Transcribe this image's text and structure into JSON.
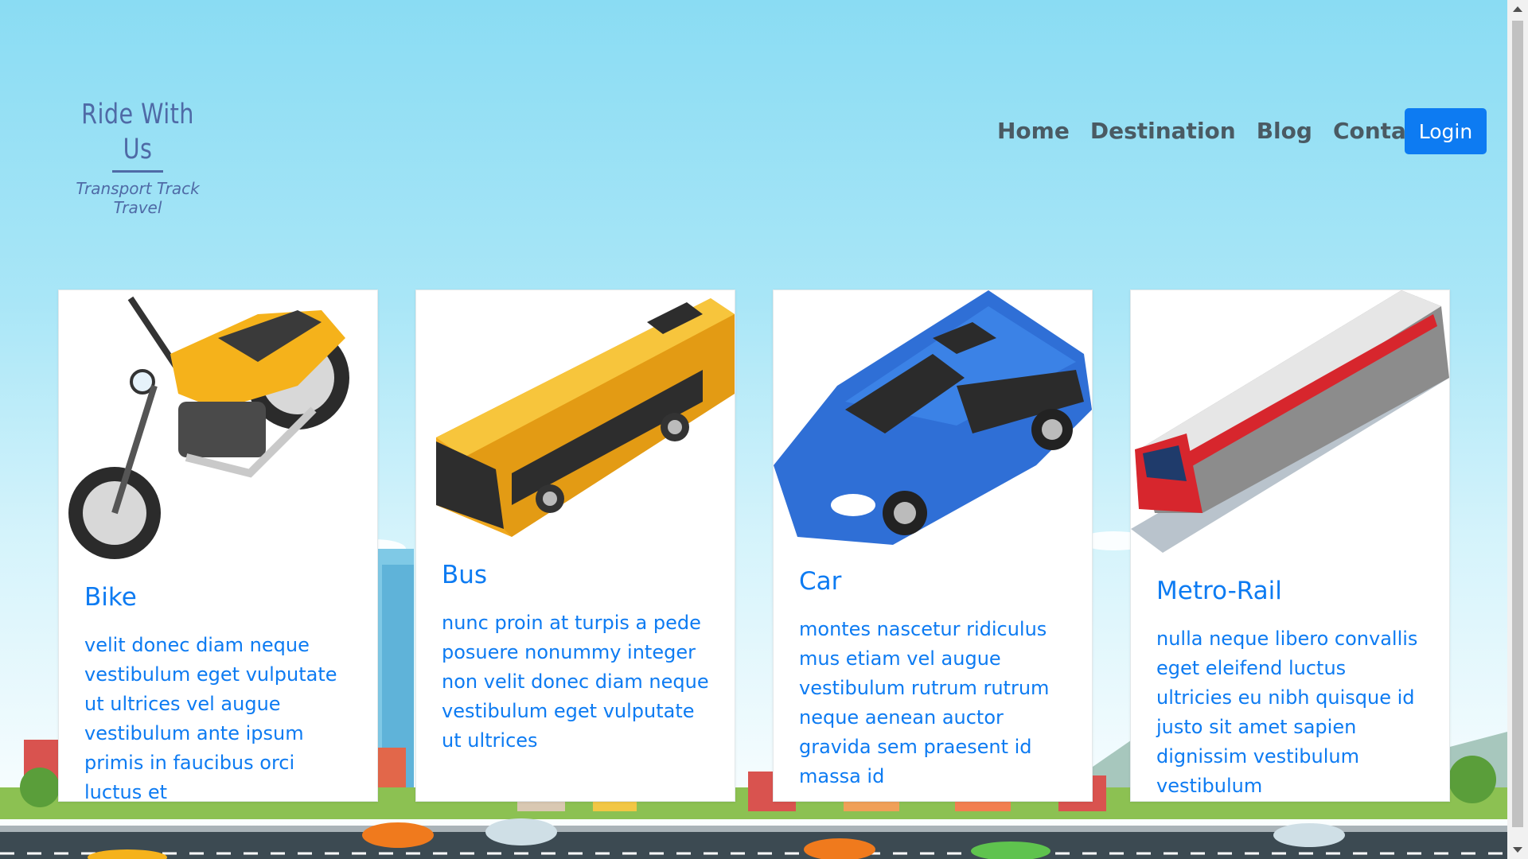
{
  "brand": {
    "title": "Ride With Us",
    "tagline": "Transport Track Travel"
  },
  "nav": {
    "items": [
      "Home",
      "Destination",
      "Blog",
      "Contact"
    ],
    "login_label": "Login"
  },
  "cards": [
    {
      "title": "Bike",
      "text": "velit donec diam neque vestibulum eget vulputate ut ultrices vel augue vestibulum ante ipsum primis in faucibus orci luctus et",
      "icon": "motorbike-illustration"
    },
    {
      "title": "Bus",
      "text": "nunc proin at turpis a pede posuere nonummy integer non velit donec diam neque vestibulum eget vulputate ut ultrices",
      "icon": "bus-illustration"
    },
    {
      "title": "Car",
      "text": "montes nascetur ridiculus mus etiam vel augue vestibulum rutrum rutrum neque aenean auctor gravida sem praesent id massa id",
      "icon": "car-illustration"
    },
    {
      "title": "Metro-Rail",
      "text": "nulla neque libero convallis eget eleifend luctus ultricies eu nibh quisque id justo sit amet sapien dignissim vestibulum vestibulum",
      "icon": "train-illustration"
    }
  ],
  "colors": {
    "accent": "#0d7bf2",
    "brand": "#4f6aa6",
    "nav_text": "#4a5a63",
    "sky": "#8adcf3"
  }
}
